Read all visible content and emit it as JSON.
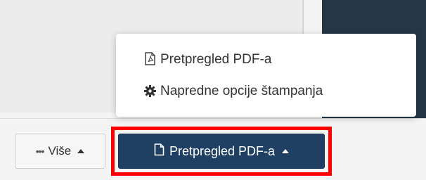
{
  "colors": {
    "panel_dark": "#243746",
    "primary_button": "#1f3f63",
    "highlight": "#ff0000",
    "menu_text": "#333333"
  },
  "dropdown": {
    "items": [
      {
        "label": "Pretpregled PDF-a",
        "icon": "pdf-file-icon"
      },
      {
        "label": "Napredne opcije štampanja",
        "icon": "gear-icon"
      }
    ]
  },
  "toolbar": {
    "more": {
      "dots": "•••",
      "label": "Više",
      "icon": "caret-up-icon"
    },
    "preview": {
      "label": "Pretpregled PDF-a",
      "icon": "file-icon",
      "caret": "caret-up-icon"
    }
  }
}
